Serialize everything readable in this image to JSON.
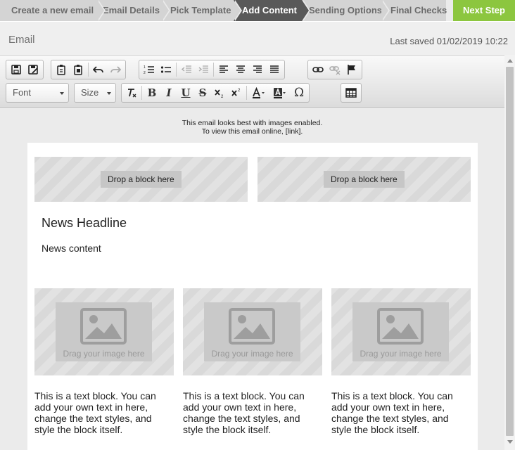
{
  "wizard": {
    "steps": [
      {
        "label": "Create a new email",
        "active": false
      },
      {
        "label": "Email Details",
        "active": false
      },
      {
        "label": "Pick Template",
        "active": false
      },
      {
        "label": "Add Content",
        "active": true
      },
      {
        "label": "Sending Options",
        "active": false
      },
      {
        "label": "Final Checks",
        "active": false
      }
    ],
    "next_label": "Next Step"
  },
  "header": {
    "title": "Email",
    "last_saved": "Last saved 01/02/2019 10:22"
  },
  "toolbar": {
    "font_label": "Font",
    "size_label": "Size",
    "buttons_row1": [
      "save-icon",
      "save-as-icon",
      "paste-icon",
      "paste-text-icon",
      "undo-icon",
      "redo-icon",
      "numbered-list-icon",
      "bulleted-list-icon",
      "decrease-indent-icon",
      "increase-indent-icon",
      "align-left-icon",
      "align-center-icon",
      "align-right-icon",
      "justify-icon",
      "link-icon",
      "unlink-icon",
      "anchor-flag-icon"
    ],
    "buttons_row2": [
      "clear-format-icon",
      "bold-icon",
      "italic-icon",
      "underline-icon",
      "strikethrough-icon",
      "subscript-icon",
      "superscript-icon",
      "text-color-icon",
      "background-color-icon",
      "special-character-icon",
      "table-icon"
    ]
  },
  "email": {
    "preheader_line1": "This email looks best with images enabled.",
    "preheader_line2": "To view this email online, [link].",
    "drop_label_left": "Drop a block here",
    "drop_label_right": "Drop a block here",
    "headline": "News Headline",
    "content": "News content",
    "image_caption_1": "Drag your image here",
    "image_caption_2": "Drag your image here",
    "image_caption_3": "Drag your image here",
    "text_block_1": "This is a text block. You can add your own text in here, change the text styles, and style the block itself.",
    "text_block_2": "This is a text block. You can add your own text in here, change the text styles, and style the block itself.",
    "text_block_3": "This is a text block. You can add your own text in here, change the text styles, and style the block itself."
  },
  "colors": {
    "active_step": "#595959",
    "next_step": "#8cc63f",
    "inactive_step": "#d4d4d4"
  }
}
